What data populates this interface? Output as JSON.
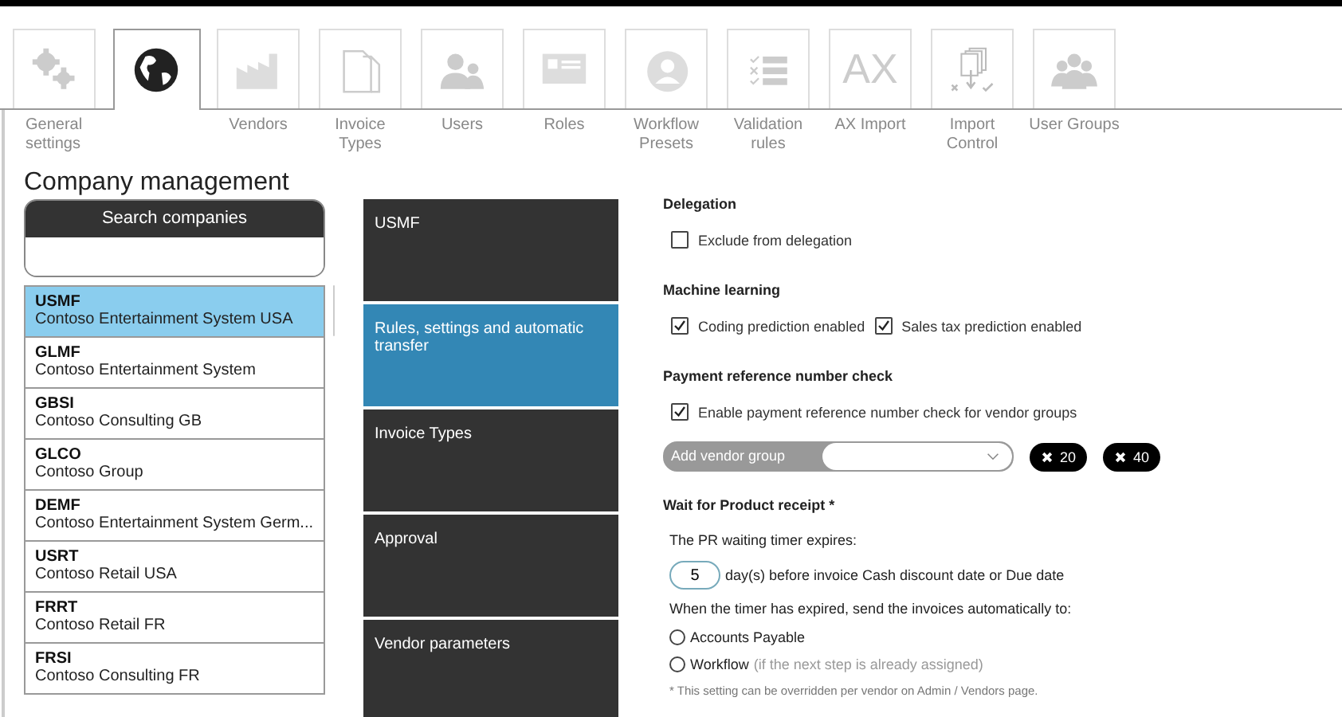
{
  "tabs": [
    {
      "label": "General settings",
      "kind": "gears",
      "selected": false
    },
    {
      "kind": "globe",
      "selected": true
    },
    {
      "label": "Vendors",
      "kind": "factory",
      "selected": false
    },
    {
      "label": "Invoice Types",
      "kind": "documents",
      "selected": false
    },
    {
      "label": "Users",
      "kind": "users",
      "selected": false
    },
    {
      "label": "Roles",
      "kind": "card",
      "selected": false
    },
    {
      "label": "Workflow Presets",
      "kind": "person",
      "selected": false
    },
    {
      "label": "Validation rules",
      "kind": "checklist",
      "selected": false
    },
    {
      "label": "AX Import",
      "kind": "text",
      "icon_text": "AX",
      "selected": false
    },
    {
      "label": "Import Control",
      "kind": "import",
      "selected": false
    },
    {
      "label": "User Groups",
      "kind": "group",
      "selected": false
    }
  ],
  "page_title": "Company management",
  "search": {
    "title": "Search companies"
  },
  "companies": [
    {
      "code": "USMF",
      "name": "Contoso Entertainment System USA",
      "selected": true
    },
    {
      "code": "GLMF",
      "name": "Contoso Entertainment System",
      "selected": false
    },
    {
      "code": "GBSI",
      "name": "Contoso Consulting GB",
      "selected": false
    },
    {
      "code": "GLCO",
      "name": "Contoso Group",
      "selected": false
    },
    {
      "code": "DEMF",
      "name": "Contoso Entertainment System Germ...",
      "selected": false
    },
    {
      "code": "USRT",
      "name": "Contoso Retail USA",
      "selected": false
    },
    {
      "code": "FRRT",
      "name": "Contoso Retail FR",
      "selected": false
    },
    {
      "code": "FRSI",
      "name": "Contoso Consulting FR",
      "selected": false
    }
  ],
  "sections": [
    {
      "label": "USMF",
      "selected": false
    },
    {
      "label": "Rules, settings and automatic transfer",
      "selected": true
    },
    {
      "label": "Invoice Types",
      "selected": false
    },
    {
      "label": "Approval",
      "selected": false
    },
    {
      "label": "Vendor parameters",
      "selected": false
    }
  ],
  "delegation": {
    "title": "Delegation",
    "options": [
      {
        "label": "Exclude from delegation",
        "checked": false
      }
    ]
  },
  "machine_learning": {
    "title": "Machine learning",
    "options": [
      {
        "label": "Coding prediction enabled",
        "checked": true
      },
      {
        "label": "Sales tax prediction enabled",
        "checked": true
      }
    ]
  },
  "payment_reference": {
    "title": "Payment reference number check",
    "options": [
      {
        "label": "Enable payment reference number check for vendor groups",
        "checked": true
      }
    ],
    "add_label": "Add vendor group",
    "tags": [
      "20",
      "40"
    ]
  },
  "product_receipt": {
    "title": "Wait for Product receipt *",
    "timer_text": "The PR waiting timer expires:",
    "days": "5",
    "days_text": "day(s) before invoice Cash discount date or Due date",
    "send_text": "When the timer has expired, send the invoices automatically to:",
    "radios": [
      {
        "label": "Accounts Payable",
        "selected": false
      },
      {
        "label": "Workflow",
        "note": "(if the next step is already assigned)",
        "selected": false
      }
    ],
    "footnote": "* This setting can be overridden per vendor on Admin / Vendors page."
  }
}
